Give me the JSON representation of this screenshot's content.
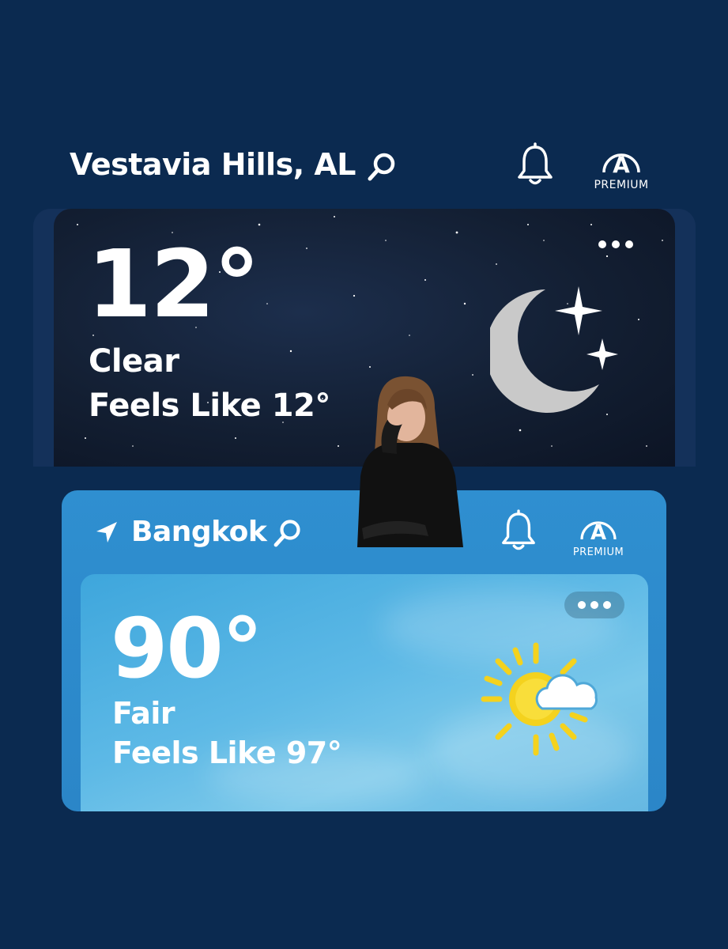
{
  "primary_location": {
    "name": "Vestavia Hills, AL",
    "premium_badge_letter": "A",
    "premium_label": "PREMIUM",
    "temperature": "12°",
    "condition": "Clear",
    "feels_like": "Feels Like 12°",
    "weather_icon": "moon-stars-icon",
    "more_icon": "more-dots-icon"
  },
  "secondary_location": {
    "name": "Bangkok",
    "premium_badge_letter": "A",
    "premium_label": "PREMIUM",
    "temperature": "90°",
    "condition": "Fair",
    "feels_like": "Feels Like 97°",
    "weather_icon": "sun-cloud-icon",
    "more_icon": "more-dots-icon"
  },
  "colors": {
    "background": "#0b2a50",
    "night_card": "#131f33",
    "day_card": "#2f8fd0",
    "sky": "#5db9e6",
    "moon": "#c8c8c8",
    "sun": "#f5d21f"
  }
}
